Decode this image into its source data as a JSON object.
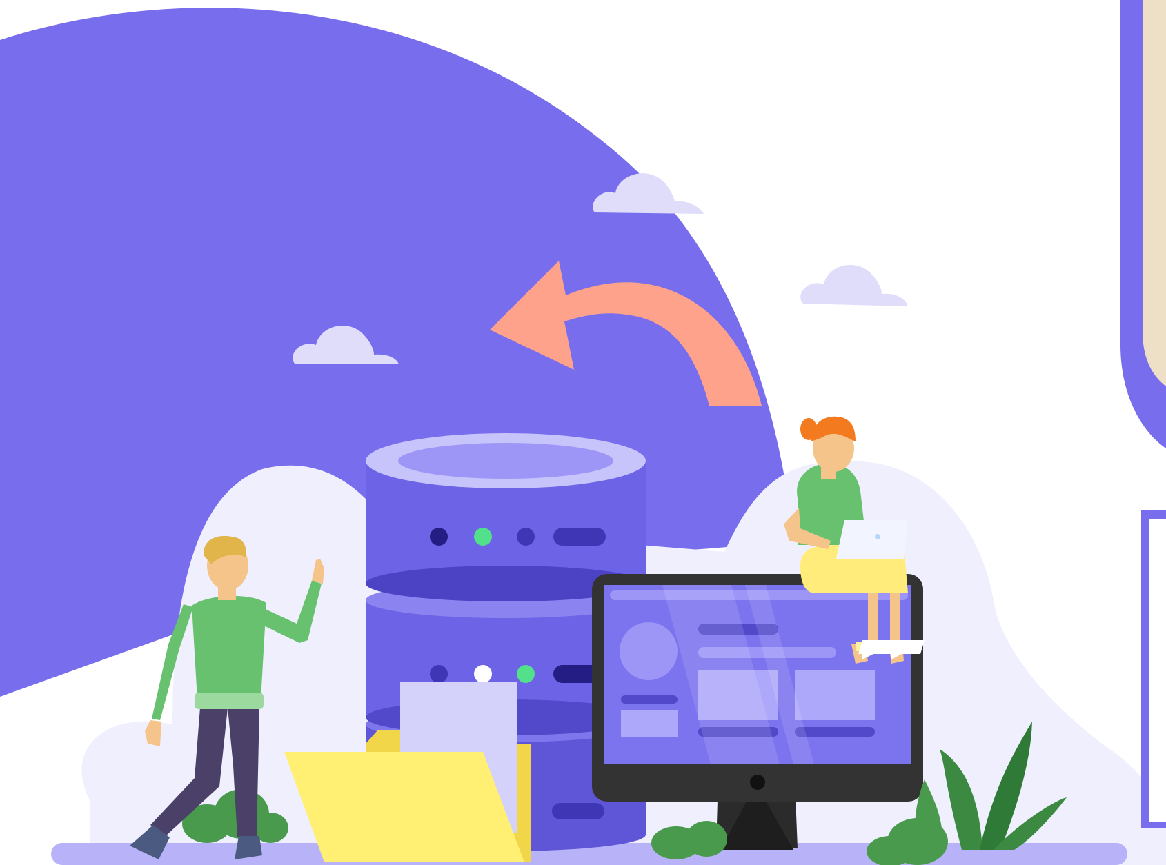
{
  "scene": {
    "subject": "data-backup-illustration",
    "colors": {
      "primary": "#776DED",
      "cloud": "#E0DDFB",
      "arrow": "#FFA28C",
      "database": "#6C63E6",
      "database_light": "#9D96F7",
      "folder": "#FFEF73",
      "monitor_frame": "#333333",
      "monitor_screen": "#7C73EE",
      "plant": "#4A9A4E",
      "shirt": "#67C16E",
      "panel_beige": "#EEDFC7",
      "ground": "#B8B3F8",
      "led_green": "#52E08A"
    },
    "icons": [
      "cloud-icon",
      "arrow-icon",
      "database-icon",
      "folder-icon",
      "monitor-icon",
      "laptop-icon",
      "plant-icon"
    ]
  }
}
